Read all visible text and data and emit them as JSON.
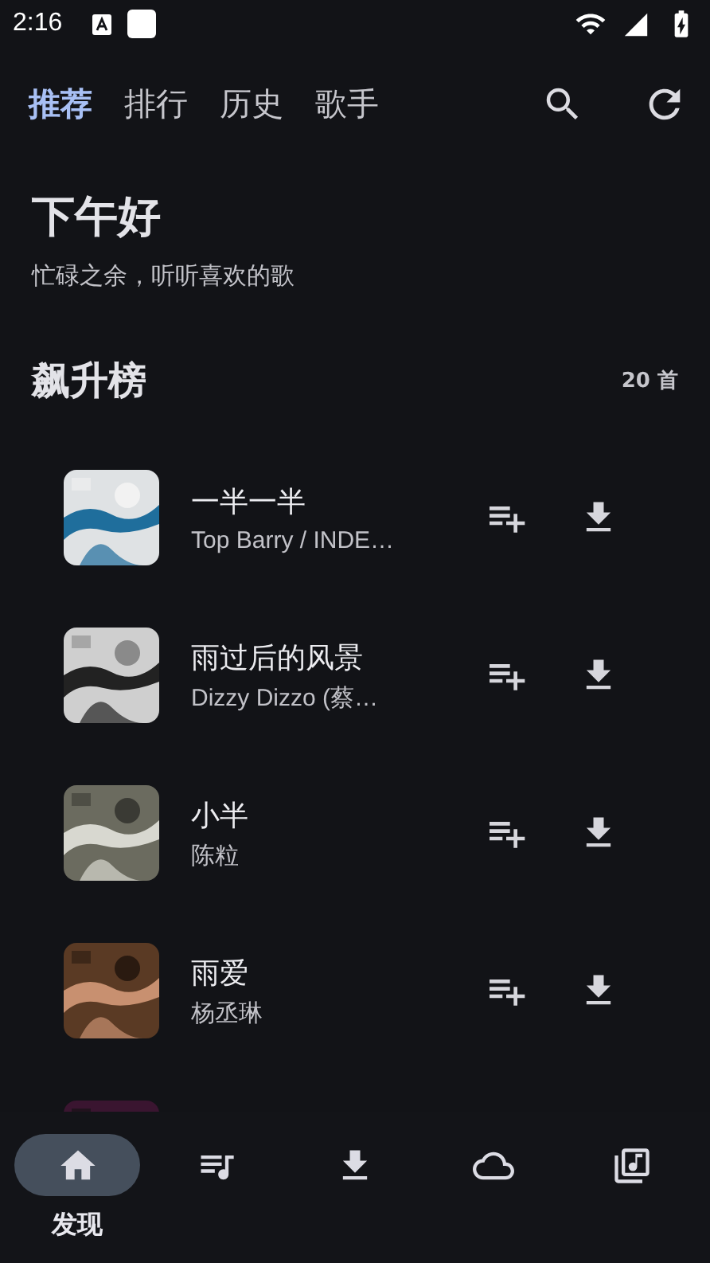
{
  "status_bar": {
    "time": "2:16"
  },
  "tabs": [
    {
      "label": "推荐",
      "selected": true
    },
    {
      "label": "排行",
      "selected": false
    },
    {
      "label": "历史",
      "selected": false
    },
    {
      "label": "歌手",
      "selected": false
    }
  ],
  "greeting": {
    "title": "下午好",
    "subtitle": "忙碌之余，听听喜欢的歌"
  },
  "chart": {
    "title": "飙升榜",
    "count": "20 首"
  },
  "songs": [
    {
      "title": "一半一半",
      "artist": "Top Barry / INDE…"
    },
    {
      "title": "雨过后的风景",
      "artist": "Dizzy Dizzo (蔡…"
    },
    {
      "title": "小半",
      "artist": "陈粒"
    },
    {
      "title": "雨爱",
      "artist": "杨丞琳"
    }
  ],
  "nav": [
    {
      "kind": "home",
      "label": "发现",
      "selected": true
    },
    {
      "kind": "playlist",
      "selected": false
    },
    {
      "kind": "download",
      "selected": false
    },
    {
      "kind": "cloud",
      "selected": false
    },
    {
      "kind": "library",
      "selected": false
    }
  ]
}
